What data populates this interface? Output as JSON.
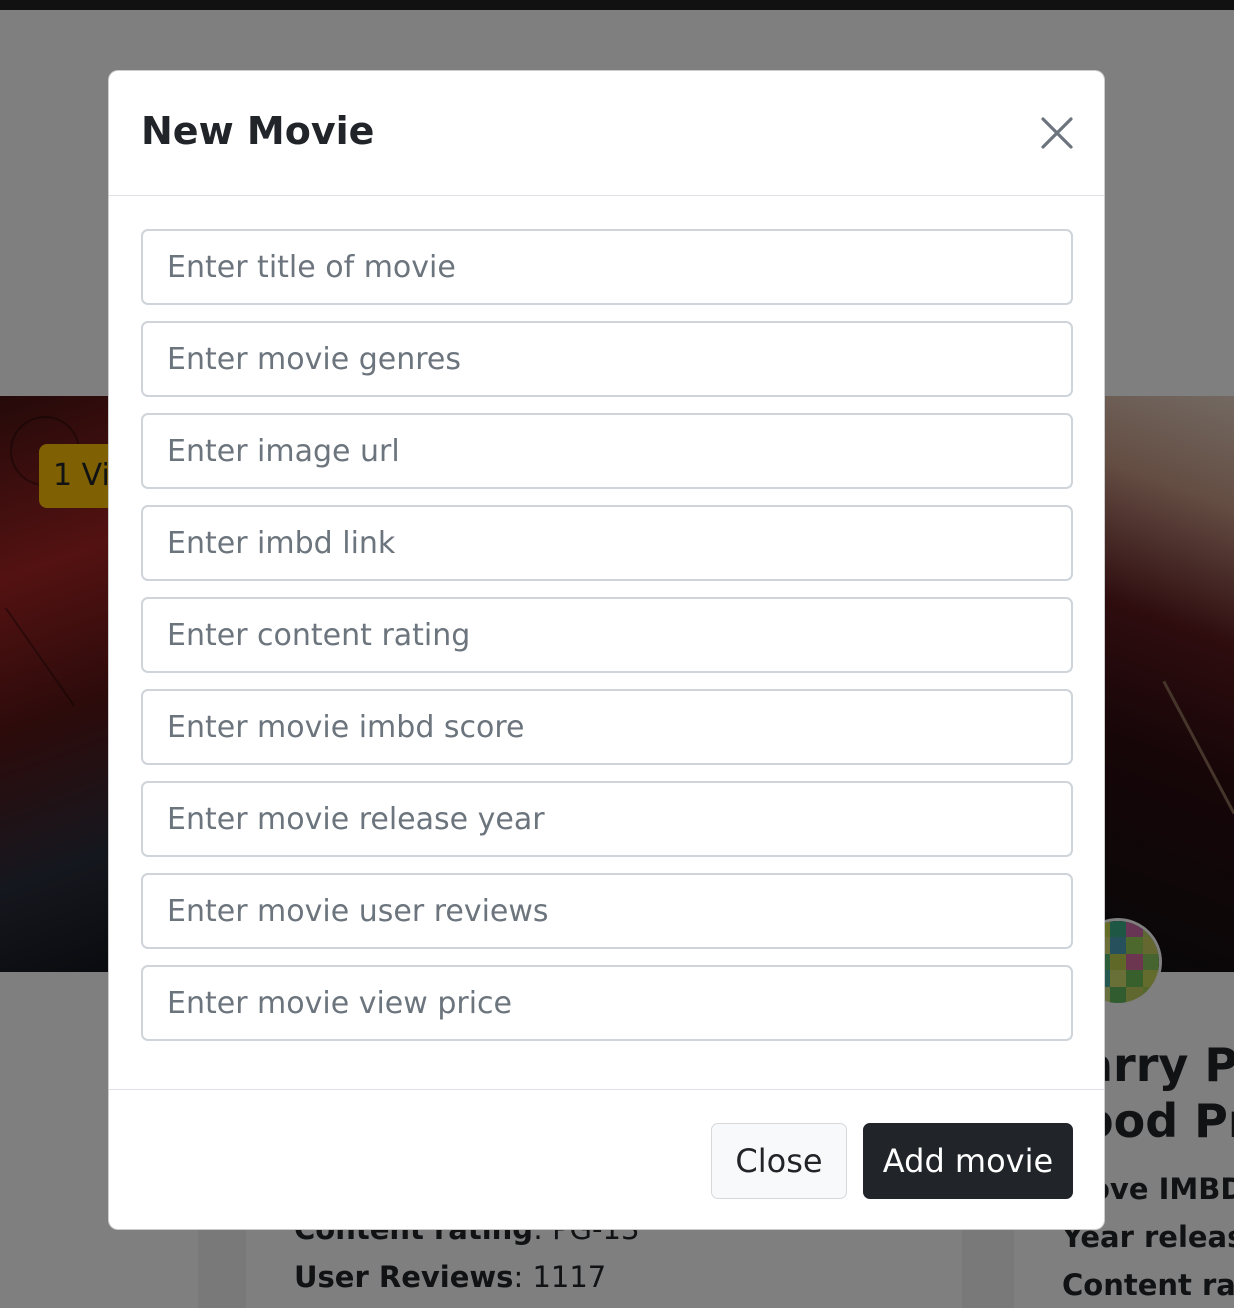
{
  "background": {
    "view_badge": "1 Vi",
    "card_mid": {
      "content_rating_label": "Content rating",
      "content_rating_value": ": PG-13",
      "user_reviews_label": "User Reviews",
      "user_reviews_value": ": 1117"
    },
    "card_right": {
      "title_line1": "arry Po",
      "title_line2": "ood Pr",
      "line1_label": "ove IMBD",
      "line2_label": "Year releas",
      "line3_label": "Content rat"
    },
    "avatar_colors": [
      "#7ec850",
      "#c8d84a",
      "#3fae8a",
      "#d06aa8",
      "#b8d060",
      "#6ab84a",
      "#d8e070",
      "#4aa0b8",
      "#9ad058",
      "#c8d060",
      "#e0e888",
      "#5ab870",
      "#c0d050",
      "#d86aa0",
      "#8ac860",
      "#b0d060",
      "#4ab0a0",
      "#d0e070",
      "#70c058",
      "#c8d85a",
      "#90c850",
      "#d0e080",
      "#60b860",
      "#c0d060",
      "#a8d058"
    ]
  },
  "modal": {
    "title": "New Movie",
    "close_icon": "close-icon",
    "fields": [
      {
        "placeholder": "Enter title of movie"
      },
      {
        "placeholder": "Enter movie genres"
      },
      {
        "placeholder": "Enter image url"
      },
      {
        "placeholder": "Enter imbd link"
      },
      {
        "placeholder": "Enter content rating"
      },
      {
        "placeholder": "Enter movie imbd score"
      },
      {
        "placeholder": "Enter movie release year"
      },
      {
        "placeholder": "Enter movie user reviews"
      },
      {
        "placeholder": "Enter movie view price"
      }
    ],
    "close_button": "Close",
    "submit_button": "Add movie"
  }
}
